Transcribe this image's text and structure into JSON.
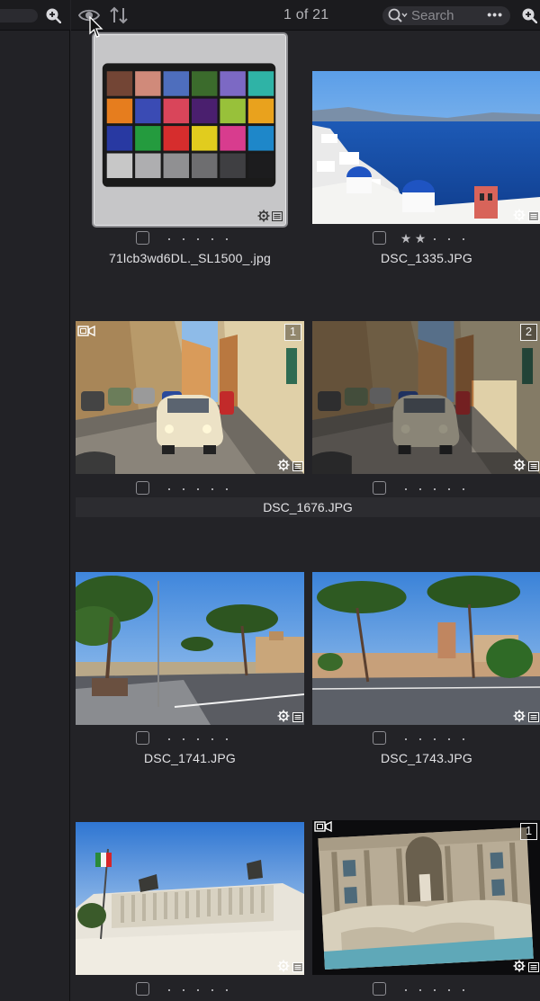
{
  "toolbar": {
    "counter": "1 of 21",
    "search_placeholder": "Search",
    "more_label": "•••"
  },
  "icons": {
    "eye": "eye-icon",
    "sort": "sort-icon",
    "search": "search-icon",
    "zoom": "zoom-in-icon",
    "gear": "gear-icon",
    "metadata": "metadata-icon",
    "video": "video-icon"
  },
  "colors": {
    "background": "#232327",
    "toolbar": "#1b1b1e",
    "text": "#e2e2e5",
    "selection_frame": "#c6c6c8"
  },
  "photos": [
    {
      "filename": "71lcb3wd6DL._SL1500_.jpg",
      "stars": 0,
      "selected_frame": true
    },
    {
      "filename": "DSC_1335.JPG",
      "stars": 2
    },
    {
      "stack_number": "1",
      "stars": 0
    },
    {
      "stack_number": "2",
      "stars": 0
    },
    {
      "filename": "DSC_1741.JPG",
      "stars": 0
    },
    {
      "filename": "DSC_1743.JPG",
      "stars": 0
    },
    {
      "stars": 0
    },
    {
      "stack_number": "1",
      "stars": 0
    }
  ],
  "stack_group": {
    "filename": "DSC_1676.JPG"
  }
}
